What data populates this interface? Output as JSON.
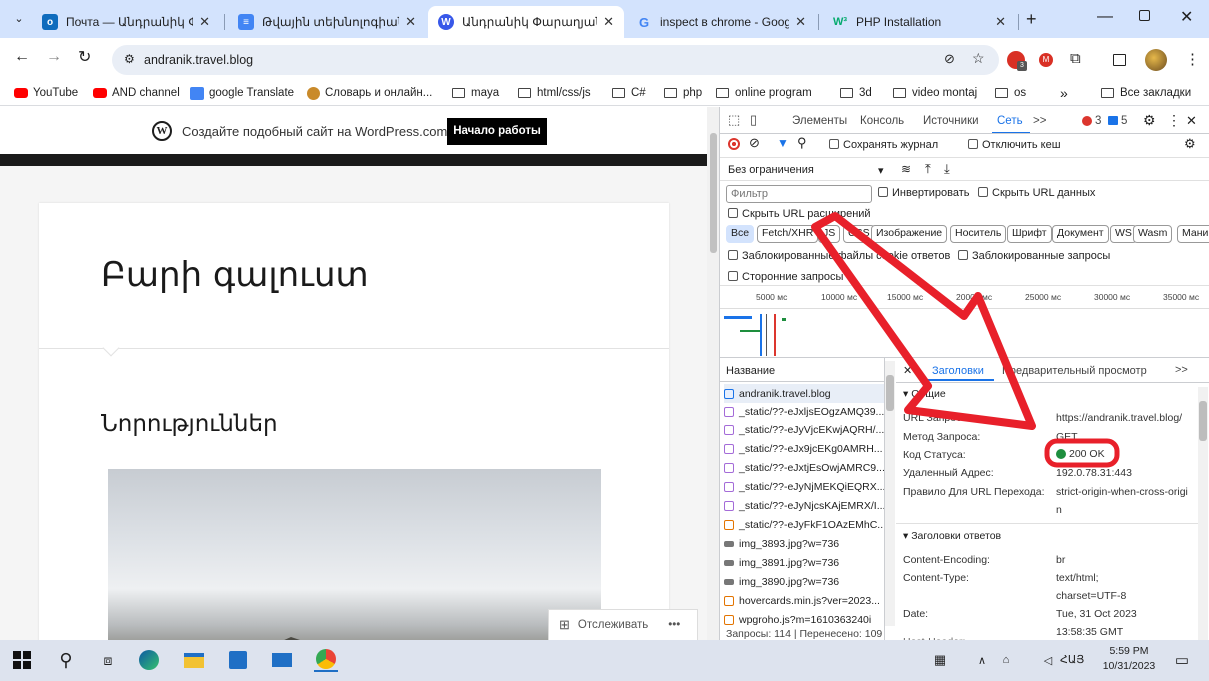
{
  "tabs": [
    {
      "title": "Почта — Անդրանիկ Փարւ",
      "active": false,
      "color": "#0f6cbd",
      "glyph": "o"
    },
    {
      "title": "Թվային տեխնոլոգիաներ",
      "active": false,
      "color": "#4285f4",
      "glyph": "≡"
    },
    {
      "title": "Անդրանիկ Փարաղյանի բ",
      "active": true,
      "color": "#3858e9",
      "glyph": "W"
    },
    {
      "title": "inspect в chrome - Google",
      "active": false,
      "color": "#ffffff",
      "glyph": "G"
    },
    {
      "title": "PHP Installation",
      "active": false,
      "color": "#ffffff",
      "glyph": "W³"
    }
  ],
  "address": {
    "url": "andranik.travel.blog"
  },
  "bookmarks": [
    {
      "label": "YouTube",
      "icon": "youtube-icon"
    },
    {
      "label": "AND channel",
      "icon": "youtube-icon"
    },
    {
      "label": "google Translate",
      "icon": "translate-icon"
    },
    {
      "label": "Словарь и онлайн...",
      "icon": "dictionary-icon"
    },
    {
      "label": "maya",
      "icon": "folder-icon"
    },
    {
      "label": "html/css/js",
      "icon": "folder-icon"
    },
    {
      "label": "C#",
      "icon": "folder-icon"
    },
    {
      "label": "php",
      "icon": "folder-icon"
    },
    {
      "label": "online program",
      "icon": "folder-icon"
    },
    {
      "label": "3d",
      "icon": "folder-icon"
    },
    {
      "label": "video montaj",
      "icon": "folder-icon"
    },
    {
      "label": "os",
      "icon": "folder-icon"
    }
  ],
  "bookmarks_more": "»",
  "all_bookmarks": "Все закладки",
  "page": {
    "wp_promo": "Создайте подобный сайт на WordPress.com",
    "wp_button": "Начало работы",
    "heading": "Բարի գալուստ",
    "section": "Նորություններ",
    "follow": "Отслеживать",
    "more": "•••"
  },
  "devtools": {
    "tabs": [
      "Элементы",
      "Консоль",
      "Источники",
      "Сеть"
    ],
    "active_tab": "Сеть",
    "more_tabs": ">>",
    "errors": "3",
    "messages": "5",
    "preserve_log": "Сохранять журнал",
    "disable_cache": "Отключить кеш",
    "throttle": "Без ограничения",
    "filter_placeholder": "Фильтр",
    "invert": "Инвертировать",
    "hide_data_urls": "Скрыть URL данных",
    "hide_ext_urls": "Скрыть URL расширений",
    "types": [
      "Все",
      "Fetch/XHR",
      "JS",
      "CSS",
      "Изображение",
      "Носитель",
      "Шрифт",
      "Документ",
      "WS",
      "Wasm",
      "Мани"
    ],
    "blocked_cookies": "Заблокированные файлы cookie ответов",
    "blocked_requests": "Заблокированные запросы",
    "third_party": "Сторонние запросы",
    "timeline": [
      "5000 мс",
      "10000 мс",
      "15000 мс",
      "20000 мс",
      "25000 мс",
      "30000 мс",
      "35000 мс"
    ],
    "name_header": "Название",
    "detail_tabs": [
      "Заголовки",
      "Предварительный просмотр"
    ],
    "detail_more": ">>",
    "requests": [
      {
        "name": "andranik.travel.blog",
        "type": "doc"
      },
      {
        "name": "_static/??-eJxljsEOgzAMQ39...",
        "type": "css"
      },
      {
        "name": "_static/??-eJyVjcEKwjAQRH/...",
        "type": "css"
      },
      {
        "name": "_static/??-eJx9jcEKg0AMRH...",
        "type": "css"
      },
      {
        "name": "_static/??-eJxtjEsOwjAMRC9...",
        "type": "css"
      },
      {
        "name": "_static/??-eJyNjMEKQiEQRX...",
        "type": "css"
      },
      {
        "name": "_static/??-eJyNjcsKAjEMRX/I...",
        "type": "css"
      },
      {
        "name": "_static/??-eJyFkF1OAzEMhC...",
        "type": "js"
      },
      {
        "name": "img_3893.jpg?w=736",
        "type": "img"
      },
      {
        "name": "img_3891.jpg?w=736",
        "type": "img"
      },
      {
        "name": "img_3890.jpg?w=736",
        "type": "img"
      },
      {
        "name": "hovercards.min.js?ver=2023...",
        "type": "js"
      },
      {
        "name": "wpgroho.js?m=1610363240i",
        "type": "js"
      }
    ],
    "footer": "Запросы: 114 | Перенесено: 109",
    "general_title": "Общие",
    "general": [
      {
        "k": "URL Запроса:",
        "v": "https://andranik.travel.blog/"
      },
      {
        "k": "Метод Запроса:",
        "v": "GET"
      },
      {
        "k": "Код Статуса:",
        "v": "200 OK"
      },
      {
        "k": "Удаленный Адрес:",
        "v": "192.0.78.31:443"
      },
      {
        "k": "Правило Для URL Перехода:",
        "v": "strict-origin-when-cross-origi"
      }
    ],
    "policy_tail": "n",
    "response_title": "Заголовки ответов",
    "response": [
      {
        "k": "Content-Encoding:",
        "v": "br"
      },
      {
        "k": "Content-Type:",
        "v": "text/html;"
      },
      {
        "k": "",
        "v": "charset=UTF-8"
      },
      {
        "k": "Date:",
        "v": "Tue, 31 Oct 2023"
      },
      {
        "k": "",
        "v": "13:58:35 GMT"
      }
    ],
    "next_key": "Host-Header:"
  },
  "taskbar": {
    "time": "5:59 PM",
    "date": "10/31/2023",
    "lang": "ՀԱՅ"
  },
  "colors": {
    "annotation": "#e8202a",
    "status_ok": "#1e8e3e",
    "devtools_accent": "#1a73e8"
  }
}
